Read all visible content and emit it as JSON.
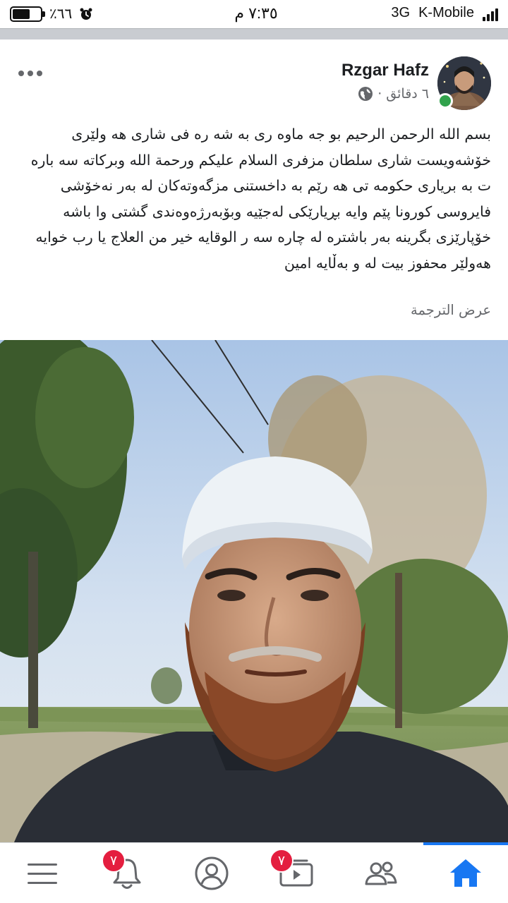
{
  "status_bar": {
    "battery_text": "٪٦٦",
    "battery_level": 0.66,
    "time": "٧:٣٥ م",
    "network": "3G",
    "carrier": "K-Mobile"
  },
  "post": {
    "author": "Rzgar Hafz",
    "time": "٦ دقائق ·",
    "privacy_icon": "globe-icon",
    "text": "بسم الله الرحمن الرحيم بو جه ماوه ری به شه ره فی شاری هه ولێری خۆشەویست شاری سلطان مزفری السلام علیكم ورحمة الله وبركاته سه باره ت به بریاری حكومه تی هه رێم به داخستنی مزگەوتەکان لە بەر نەخۆشی فایروسی كورونا پێم وایه بڕیارێكی لەجێیە وبۆبەرژەوەندی گشتی وا باشه خۆپارێزی بگرینە بەر باشترە لە چاره سه ر الوقایه خیر من العلاج یا رب خوایه هەولێر محفوز بیت لە و بەڵایە امین",
    "see_translation": "عرض الترجمة"
  },
  "bottom_nav": {
    "notifications_badge": "٧",
    "watch_badge": "٧",
    "active_tab": "home",
    "accent_color": "#1877f2",
    "badge_color": "#e41e3f"
  }
}
